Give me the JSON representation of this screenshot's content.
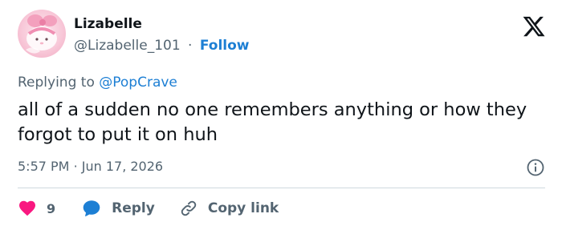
{
  "author": {
    "name": "Lizabelle",
    "handle": "@Lizabelle_101",
    "separator": "·",
    "follow_label": "Follow",
    "avatar_icon": "pink-melody-character-avatar"
  },
  "platform_icon": "x-logo-icon",
  "reply_context": {
    "prefix": "Replying to",
    "mention": "@PopCrave"
  },
  "tweet": {
    "text": "all of a sudden no one remembers anything or how they forgot to put it on huh"
  },
  "meta": {
    "time": "5:57 PM",
    "separator": "·",
    "date": "Jun 17, 2026",
    "info_icon": "info-icon"
  },
  "actions": {
    "like_count": "9",
    "reply_label": "Reply",
    "copy_label": "Copy link"
  },
  "colors": {
    "link_blue": "#1d7fd4",
    "like_red": "#f91880",
    "secondary_text": "#536471",
    "primary_text": "#0f1419",
    "divider": "#cfd9de"
  }
}
